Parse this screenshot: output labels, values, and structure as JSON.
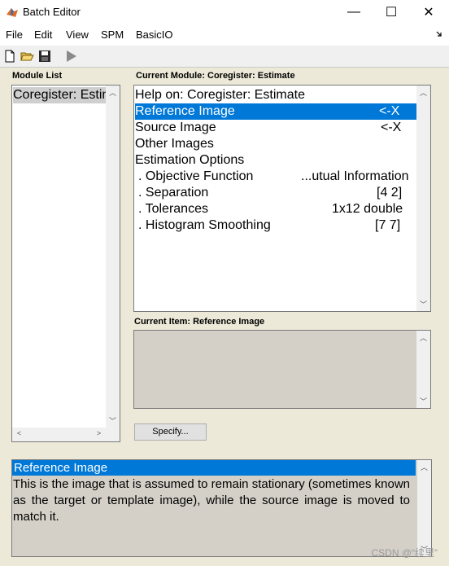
{
  "window": {
    "title": "Batch Editor",
    "minimize": "—",
    "maximize": "☐",
    "close": "✕"
  },
  "menu": [
    "File",
    "Edit",
    "View",
    "SPM",
    "BasicIO"
  ],
  "toolbar": {
    "icons": [
      "new-file-icon",
      "open-folder-icon",
      "save-icon",
      "run-icon"
    ]
  },
  "module_list": {
    "label": "Module List",
    "items": [
      "Coregister: Estim"
    ]
  },
  "current_module": {
    "label": "Current Module: Coregister: Estimate",
    "rows": [
      {
        "name": "Help on: Coregister: Estimate",
        "value": ""
      },
      {
        "name": "Reference Image",
        "value": "<-X"
      },
      {
        "name": "Source Image",
        "value": "<-X"
      },
      {
        "name": "Other Images",
        "value": ""
      },
      {
        "name": "Estimation Options",
        "value": ""
      },
      {
        "name": ". Objective Function",
        "value": "...utual Information"
      },
      {
        "name": ". Separation",
        "value": "[4 2]"
      },
      {
        "name": ". Tolerances",
        "value": "1x12 double"
      },
      {
        "name": ". Histogram Smoothing",
        "value": "[7 7]"
      }
    ],
    "selected_index": 1
  },
  "current_item": {
    "label": "Current Item: Reference Image"
  },
  "specify_button": "Specify...",
  "help": {
    "heading": "Reference Image",
    "text": "This is the image that is assumed to remain stationary (sometimes known as the target or template image), while the source image is moved to match it."
  },
  "watermark": "CSDN @“续里”"
}
